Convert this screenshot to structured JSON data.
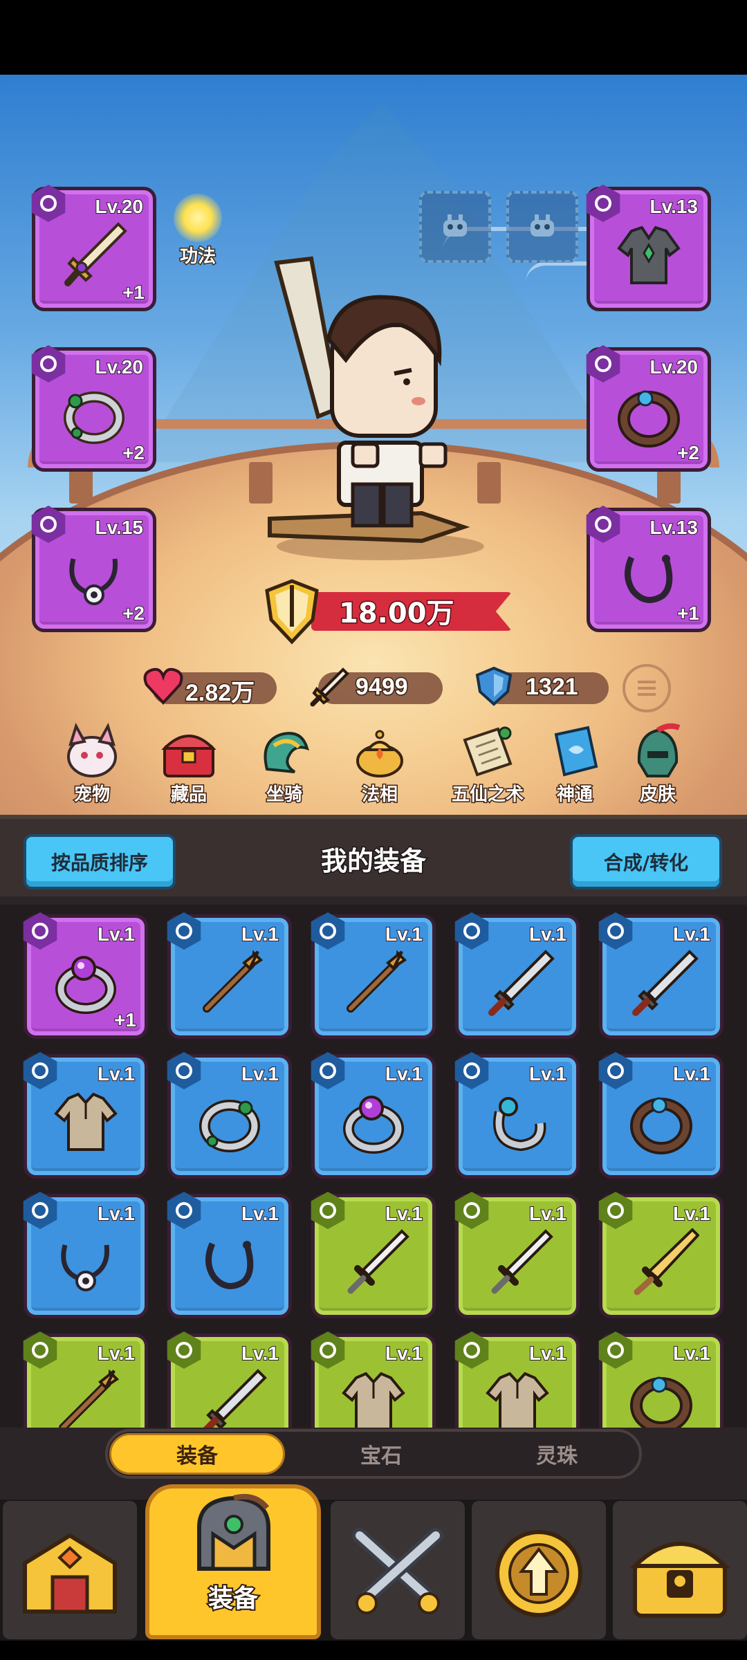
{
  "game": {
    "gongfa_label": "功法",
    "power_value": "18.00万",
    "stats": {
      "hp": "2.82万",
      "attack": "9499",
      "defense": "1321"
    },
    "equipped": [
      {
        "slot": "weapon",
        "level": "Lv.20",
        "plus": "+1",
        "quality": "purple",
        "icon": "sword-icon"
      },
      {
        "slot": "ring",
        "level": "Lv.20",
        "plus": "+2",
        "quality": "purple",
        "icon": "ring-icon"
      },
      {
        "slot": "necklace",
        "level": "Lv.15",
        "plus": "+2",
        "quality": "purple",
        "icon": "necklace-icon"
      },
      {
        "slot": "armor",
        "level": "Lv.13",
        "plus": "",
        "quality": "purple",
        "icon": "robe-icon"
      },
      {
        "slot": "bracelet",
        "level": "Lv.20",
        "plus": "+2",
        "quality": "purple",
        "icon": "bracelet-icon"
      },
      {
        "slot": "pendant",
        "level": "Lv.13",
        "plus": "+1",
        "quality": "purple",
        "icon": "pendant-icon"
      }
    ],
    "features": [
      {
        "label": "宠物",
        "icon": "pet-icon"
      },
      {
        "label": "藏品",
        "icon": "collection-chest-icon"
      },
      {
        "label": "坐骑",
        "icon": "mount-icon"
      },
      {
        "label": "法相",
        "icon": "dharma-incense-icon"
      },
      {
        "label": "五仙之术",
        "icon": "scroll-icon"
      },
      {
        "label": "神通",
        "icon": "spellbook-icon"
      },
      {
        "label": "皮肤",
        "icon": "skin-helmet-icon"
      }
    ]
  },
  "panel": {
    "sort_button": "按品质排序",
    "title": "我的装备",
    "merge_button": "合成/转化"
  },
  "inventory": [
    {
      "level": "Lv.1",
      "plus": "+1",
      "quality": "purple",
      "type": "ring",
      "icon": "gem-ring-icon"
    },
    {
      "level": "Lv.1",
      "plus": "",
      "quality": "blue",
      "type": "weapon",
      "icon": "spear-icon"
    },
    {
      "level": "Lv.1",
      "plus": "",
      "quality": "blue",
      "type": "weapon",
      "icon": "spear-icon"
    },
    {
      "level": "Lv.1",
      "plus": "",
      "quality": "blue",
      "type": "weapon",
      "icon": "blade-icon"
    },
    {
      "level": "Lv.1",
      "plus": "",
      "quality": "blue",
      "type": "weapon",
      "icon": "blade-icon"
    },
    {
      "level": "Lv.1",
      "plus": "",
      "quality": "blue",
      "type": "armor",
      "icon": "shirt-icon"
    },
    {
      "level": "Lv.1",
      "plus": "",
      "quality": "blue",
      "type": "ring",
      "icon": "jade-ring-icon"
    },
    {
      "level": "Lv.1",
      "plus": "",
      "quality": "blue",
      "type": "ring",
      "icon": "gem-ring-icon"
    },
    {
      "level": "Lv.1",
      "plus": "",
      "quality": "blue",
      "type": "ring",
      "icon": "open-ring-icon"
    },
    {
      "level": "Lv.1",
      "plus": "",
      "quality": "blue",
      "type": "ring",
      "icon": "bangle-icon"
    },
    {
      "level": "Lv.1",
      "plus": "",
      "quality": "blue",
      "type": "necklace",
      "icon": "necklace-icon"
    },
    {
      "level": "Lv.1",
      "plus": "",
      "quality": "blue",
      "type": "necklace",
      "icon": "pendant-icon"
    },
    {
      "level": "Lv.1",
      "plus": "",
      "quality": "green",
      "type": "weapon",
      "icon": "sword-icon"
    },
    {
      "level": "Lv.1",
      "plus": "",
      "quality": "green",
      "type": "weapon",
      "icon": "sword-icon"
    },
    {
      "level": "Lv.1",
      "plus": "",
      "quality": "green",
      "type": "weapon",
      "icon": "golden-blade-icon"
    },
    {
      "level": "Lv.1",
      "plus": "",
      "quality": "green",
      "type": "weapon",
      "icon": "spear-icon"
    },
    {
      "level": "Lv.1",
      "plus": "",
      "quality": "green",
      "type": "weapon",
      "icon": "blade-icon"
    },
    {
      "level": "Lv.1",
      "plus": "",
      "quality": "green",
      "type": "armor",
      "icon": "shirt-icon"
    },
    {
      "level": "Lv.1",
      "plus": "",
      "quality": "green",
      "type": "armor",
      "icon": "shirt-icon"
    },
    {
      "level": "Lv.1",
      "plus": "",
      "quality": "green",
      "type": "ring",
      "icon": "bangle-icon"
    }
  ],
  "tabs": [
    {
      "label": "装备",
      "active": true
    },
    {
      "label": "宝石",
      "active": false
    },
    {
      "label": "灵珠",
      "active": false
    }
  ],
  "nav": [
    {
      "label": "",
      "icon": "shop-icon",
      "active": false
    },
    {
      "label": "装备",
      "icon": "helmet-icon",
      "active": true
    },
    {
      "label": "",
      "icon": "battle-swords-icon",
      "active": false
    },
    {
      "label": "",
      "icon": "upgrade-arrow-icon",
      "active": false
    },
    {
      "label": "",
      "icon": "treasure-chest-icon",
      "active": false
    }
  ],
  "colors": {
    "purple": "#b84fd9",
    "blue": "#3d93df",
    "green": "#9cc234",
    "accent_yellow": "#ffc52a",
    "button_blue": "#49c6f5",
    "power_red": "#d52d3d"
  }
}
